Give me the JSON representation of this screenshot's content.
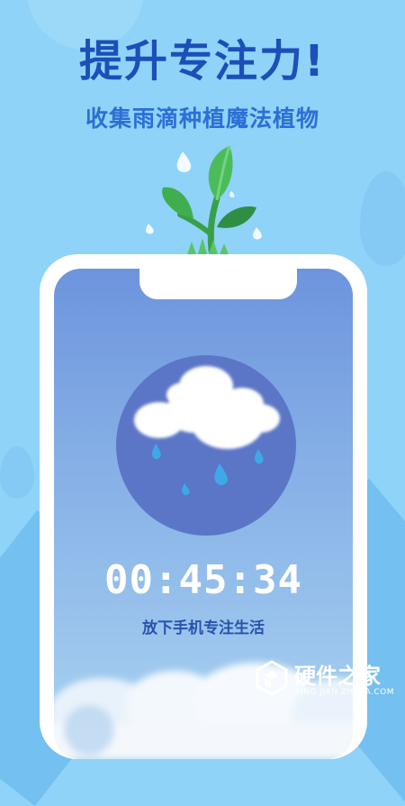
{
  "headline": "提升专注力!",
  "subhead": "收集雨滴种植魔法植物",
  "timer": {
    "value": "00:45:34",
    "caption": "放下手机专注生活"
  },
  "watermark": {
    "name": "硬件之家",
    "sub": "YING JIAN ZHI JIA.COM"
  },
  "colors": {
    "background": "#8fd3f8",
    "headline": "#1c4fb8",
    "subhead": "#2c6fd6",
    "circle": "#5b76c6",
    "caption": "#2752ad",
    "leaf": "#4cbc5a"
  },
  "icons": [
    "sprout-icon",
    "cloud-rain-icon",
    "raindrop-icon"
  ]
}
